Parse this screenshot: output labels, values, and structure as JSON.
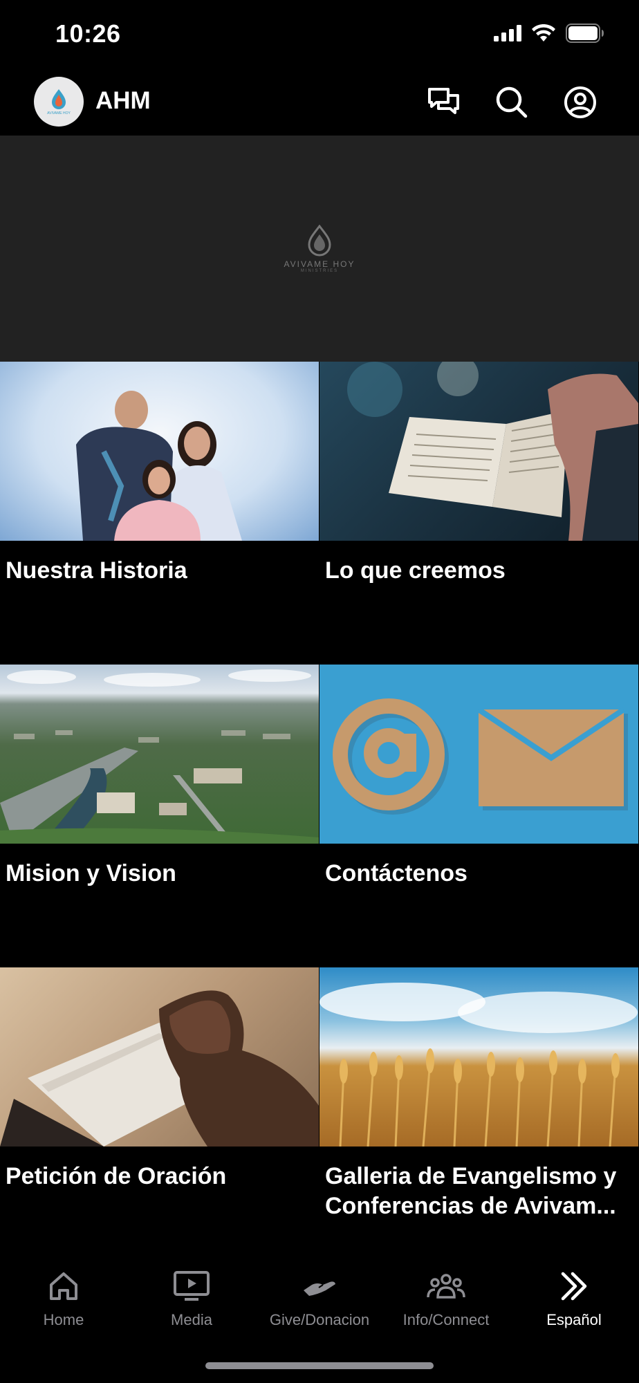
{
  "status_bar": {
    "time": "10:26"
  },
  "header": {
    "title": "AHM",
    "logo_text": "AVIVAME HOY"
  },
  "hero": {
    "logo_text": "AVIVAME HOY",
    "logo_subtext": "MINISTRIES"
  },
  "tiles": [
    {
      "label": "Nuestra Historia",
      "image": "family-photo"
    },
    {
      "label": "Lo que creemos",
      "image": "open-bible-photo"
    },
    {
      "label": "Mision y Vision",
      "image": "aerial-city-photo"
    },
    {
      "label": "Contáctenos",
      "image": "email-symbols-photo"
    },
    {
      "label": "Petición de Oración",
      "image": "praying-hands-photo"
    },
    {
      "label": "Galleria de Evangelismo y Conferencias de Avivam...",
      "image": "wheat-field-photo"
    }
  ],
  "tab_bar": {
    "items": [
      {
        "label": "Home",
        "icon": "home-icon",
        "active": false
      },
      {
        "label": "Media",
        "icon": "media-icon",
        "active": false
      },
      {
        "label": "Give/Donacion",
        "icon": "give-icon",
        "active": false
      },
      {
        "label": "Info/Connect",
        "icon": "people-icon",
        "active": false
      },
      {
        "label": "Español",
        "icon": "double-chevron-icon",
        "active": true
      }
    ]
  },
  "colors": {
    "background": "#000000",
    "hero_bg": "#222222",
    "inactive_tab": "#8e8e93",
    "active_tab": "#ffffff"
  }
}
